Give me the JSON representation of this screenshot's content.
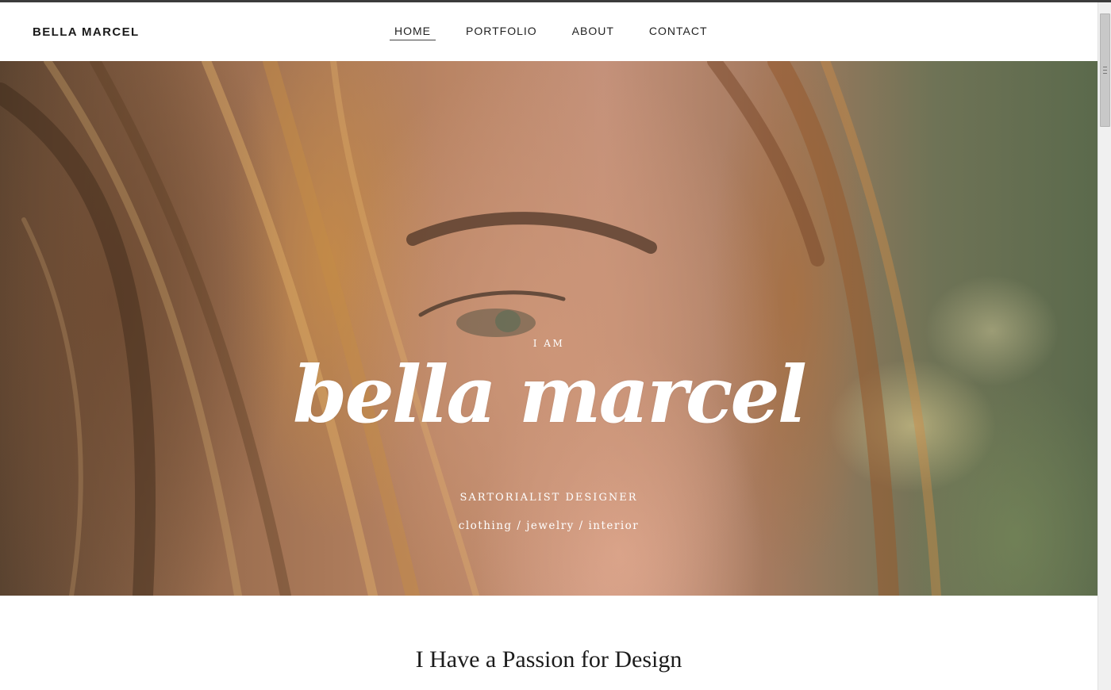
{
  "header": {
    "brand": "BELLA MARCEL",
    "nav": [
      {
        "label": "HOME",
        "active": true
      },
      {
        "label": "PORTFOLIO",
        "active": false
      },
      {
        "label": "ABOUT",
        "active": false
      },
      {
        "label": "CONTACT",
        "active": false
      }
    ]
  },
  "hero": {
    "eyebrow": "I AM",
    "name": "bella marcel",
    "role": "SARTORIALIST DESIGNER",
    "disciplines": "clothing / jewelry / interior"
  },
  "section": {
    "title": "I Have a Passion for Design"
  },
  "colors": {
    "text_dark": "#1a1a1a",
    "hero_text": "#ffffff",
    "background": "#ffffff"
  }
}
